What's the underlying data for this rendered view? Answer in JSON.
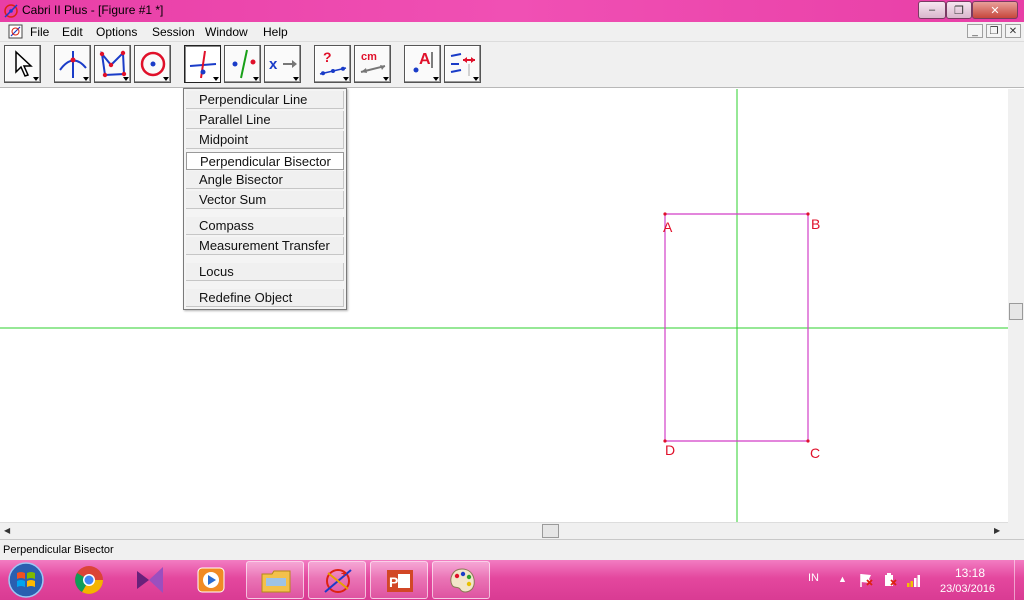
{
  "window": {
    "title": "Cabri II Plus - [Figure #1 *]",
    "minimize": "–",
    "maximize": "❐",
    "close": "✕"
  },
  "menubar": {
    "items": [
      "File",
      "Edit",
      "Options",
      "Session",
      "Window",
      "Help"
    ],
    "mdi_min": "_",
    "mdi_restore": "❐",
    "mdi_close": "✕"
  },
  "toolbar": {
    "tools": [
      "pointer-tool",
      "points-tool",
      "lines-tool",
      "curves-tool",
      "construct-tool",
      "transform-tool",
      "macro-tool",
      "check-property-tool",
      "measure-tool",
      "display-tool",
      "drawing-tool"
    ],
    "active_tool": "construct-tool"
  },
  "construct_menu": {
    "items": [
      {
        "label": "Perpendicular Line",
        "selected": false
      },
      {
        "label": "Parallel Line",
        "selected": false
      },
      {
        "label": "Midpoint",
        "selected": false
      },
      {
        "label": "Perpendicular Bisector",
        "selected": true
      },
      {
        "label": "Angle Bisector",
        "selected": false
      },
      {
        "label": "Vector Sum",
        "selected": false
      },
      {
        "label": "Compass",
        "selected": false
      },
      {
        "label": "Measurement Transfer",
        "selected": false
      },
      {
        "label": "Locus",
        "selected": false
      },
      {
        "label": "Redefine Object",
        "selected": false
      }
    ]
  },
  "figure": {
    "points": [
      "A",
      "B",
      "C",
      "D"
    ],
    "colors": {
      "polygon": "#d23fc8",
      "bisector_lines": "#2ed12e",
      "point_labels": "#e0102a"
    }
  },
  "statusbar": {
    "text": "Perpendicular Bisector"
  },
  "taskbar": {
    "apps": [
      "start-orb",
      "chrome",
      "visual-studio",
      "media-player",
      "file-explorer",
      "cabri",
      "powerpoint",
      "paint"
    ],
    "language": "IN",
    "tray_up_arrow": "▲",
    "time": "13:18",
    "date": "23/03/2016"
  }
}
